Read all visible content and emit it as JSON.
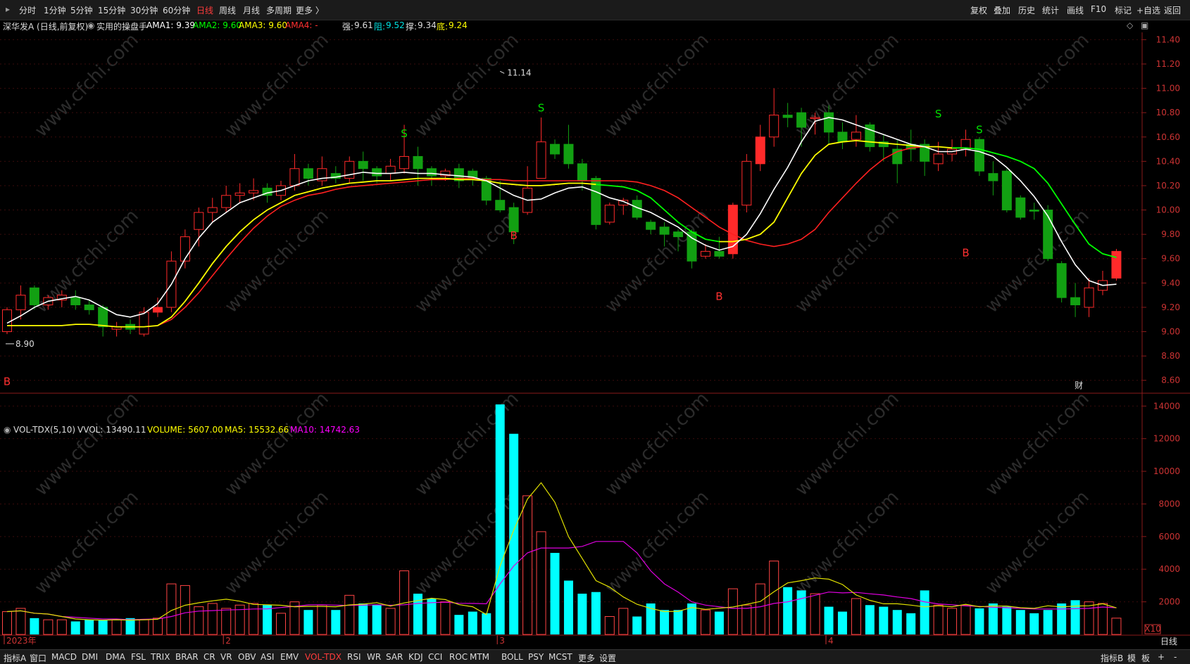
{
  "topbar": {
    "left_items": [
      "分时",
      "1分钟",
      "5分钟",
      "15分钟",
      "30分钟",
      "60分钟",
      "日线",
      "周线",
      "月线",
      "多周期",
      "更多 〉"
    ],
    "active_index": 6,
    "right_items": [
      "复权",
      "叠加",
      "历史",
      "统计",
      "画线",
      "F10",
      "标记",
      "+自选",
      "返回"
    ]
  },
  "info": {
    "stock": "深华发A (日线,前复权)",
    "indicator": "实用的操盘手",
    "ama1": "AMA1: 9.39",
    "ama2": "AMA2: 9.60",
    "ama3": "AMA3: 9.60",
    "ama4": "AMA4: -",
    "strong_label": "强:",
    "strong_value": "9.61",
    "resist_label": "阻:",
    "resist_value": "9.52",
    "support_label": "撑:",
    "support_value": "9.34",
    "bottom_label": "底:",
    "bottom_value": "9.24"
  },
  "volume_info": {
    "name": "VOL-TDX(5,10)",
    "vvol": "VVOL: 13490.11",
    "volume": "VOLUME: 5607.00",
    "ma5": "MA5: 15532.66",
    "ma10": "MA10: 14742.63"
  },
  "bottombar": {
    "items": [
      "指标A",
      "窗口",
      "MACD",
      "DMI",
      "DMA",
      "FSL",
      "TRIX",
      "BRAR",
      "CR",
      "VR",
      "OBV",
      "ASI",
      "EMV",
      "VOL-TDX",
      "RSI",
      "WR",
      "SAR",
      "KDJ",
      "CCI",
      "ROC",
      "MTM",
      "BOLL",
      "PSY",
      "MCST",
      "更多",
      "设置"
    ],
    "active_index": 13,
    "right_items": [
      "指标B",
      "模",
      "板",
      "+",
      "-"
    ]
  },
  "colors": {
    "up": "#ff2a2a",
    "down": "#12a012",
    "vol_up": "#ff4444",
    "vol_down": "#00ffff",
    "ama1": "#ffffff",
    "ama2_green": "#00ff00",
    "ama2_yellow": "#ffff00",
    "ama3_red": "#ff2020",
    "ma5": "#e0e000",
    "ma10": "#e000e0"
  },
  "chart_data": {
    "type": "candlestick",
    "price_ticks": [
      "11.40",
      "11.20",
      "11.00",
      "10.80",
      "10.60",
      "10.40",
      "10.20",
      "10.00",
      "9.80",
      "9.60",
      "9.40",
      "9.20",
      "9.00",
      "8.80",
      "8.60"
    ],
    "volume_ticks": [
      "14000",
      "12000",
      "10000",
      "8000",
      "6000",
      "4000",
      "2000"
    ],
    "volume_unit": "X10",
    "x_labels": [
      "2023年",
      "2",
      "3",
      "4"
    ],
    "period_label": "日线",
    "annotations": {
      "high": "11.14",
      "low": "8.90",
      "cai": "财"
    },
    "candles": [
      [
        9.0,
        9.18,
        9.2,
        8.98,
        1400
      ],
      [
        9.18,
        9.3,
        9.38,
        9.1,
        1600
      ],
      [
        9.36,
        9.22,
        9.38,
        9.18,
        1000
      ],
      [
        9.22,
        9.28,
        9.3,
        9.18,
        900
      ],
      [
        9.26,
        9.3,
        9.34,
        9.2,
        900
      ],
      [
        9.28,
        9.22,
        9.34,
        9.18,
        800
      ],
      [
        9.22,
        9.18,
        9.26,
        9.14,
        900
      ],
      [
        9.2,
        9.04,
        9.22,
        8.96,
        900
      ],
      [
        9.02,
        9.04,
        9.08,
        8.96,
        900
      ],
      [
        9.06,
        9.02,
        9.1,
        8.98,
        1000
      ],
      [
        8.98,
        9.16,
        9.2,
        8.96,
        900
      ],
      [
        9.16,
        9.2,
        9.28,
        9.12,
        1000
      ],
      [
        9.2,
        9.58,
        9.66,
        9.16,
        3100
      ],
      [
        9.58,
        9.78,
        9.84,
        9.52,
        3000
      ],
      [
        9.84,
        9.98,
        10.02,
        9.7,
        1700
      ],
      [
        9.98,
        10.02,
        10.1,
        9.9,
        1900
      ],
      [
        10.02,
        10.12,
        10.2,
        9.98,
        1600
      ],
      [
        10.12,
        10.14,
        10.22,
        10.06,
        1800
      ],
      [
        10.14,
        10.16,
        10.26,
        10.08,
        1900
      ],
      [
        10.18,
        10.12,
        10.22,
        10.06,
        1800
      ],
      [
        10.12,
        10.2,
        10.24,
        10.08,
        1300
      ],
      [
        10.2,
        10.34,
        10.46,
        10.16,
        2000
      ],
      [
        10.34,
        10.26,
        10.38,
        10.2,
        1500
      ],
      [
        10.24,
        10.34,
        10.44,
        10.2,
        1800
      ],
      [
        10.3,
        10.26,
        10.36,
        10.22,
        1500
      ],
      [
        10.26,
        10.4,
        10.44,
        10.22,
        2400
      ],
      [
        10.4,
        10.34,
        10.48,
        10.24,
        1900
      ],
      [
        10.34,
        10.28,
        10.36,
        10.22,
        1800
      ],
      [
        10.3,
        10.36,
        10.42,
        10.24,
        1600
      ],
      [
        10.34,
        10.44,
        10.7,
        10.3,
        3900
      ],
      [
        10.44,
        10.34,
        10.52,
        10.2,
        2500
      ],
      [
        10.34,
        10.28,
        10.36,
        10.2,
        2200
      ],
      [
        10.28,
        10.32,
        10.34,
        10.24,
        2000
      ],
      [
        10.34,
        10.24,
        10.38,
        10.18,
        1200
      ],
      [
        10.32,
        10.26,
        10.34,
        10.2,
        1400
      ],
      [
        10.26,
        10.08,
        10.28,
        10.04,
        1300
      ],
      [
        10.08,
        10.0,
        10.24,
        9.98,
        14100
      ],
      [
        10.02,
        9.82,
        10.06,
        9.72,
        12300
      ],
      [
        9.98,
        10.18,
        10.36,
        9.96,
        8500
      ],
      [
        10.26,
        10.56,
        10.76,
        10.26,
        6300
      ],
      [
        10.54,
        10.46,
        10.58,
        10.42,
        5000
      ],
      [
        10.54,
        10.38,
        10.7,
        10.34,
        3300
      ],
      [
        10.38,
        10.24,
        10.42,
        10.16,
        2500
      ],
      [
        10.26,
        9.88,
        10.28,
        9.84,
        2600
      ],
      [
        9.9,
        10.04,
        10.06,
        9.88,
        1100
      ],
      [
        10.04,
        10.08,
        10.1,
        9.96,
        1600
      ],
      [
        10.08,
        9.94,
        10.12,
        9.92,
        1100
      ],
      [
        9.9,
        9.84,
        9.92,
        9.8,
        1900
      ],
      [
        9.86,
        9.8,
        9.9,
        9.7,
        1500
      ],
      [
        9.82,
        9.78,
        9.84,
        9.66,
        1500
      ],
      [
        9.82,
        9.58,
        9.84,
        9.52,
        1900
      ],
      [
        9.62,
        9.66,
        9.72,
        9.6,
        1500
      ],
      [
        9.66,
        9.62,
        9.78,
        9.6,
        1400
      ],
      [
        9.64,
        10.04,
        10.06,
        9.6,
        2800
      ],
      [
        10.04,
        10.4,
        10.46,
        9.98,
        1800
      ],
      [
        10.38,
        10.6,
        10.7,
        10.32,
        3100
      ],
      [
        10.6,
        10.78,
        11.0,
        10.52,
        4500
      ],
      [
        10.78,
        10.76,
        10.88,
        10.68,
        2900
      ],
      [
        10.8,
        10.68,
        10.84,
        10.52,
        2700
      ],
      [
        10.76,
        10.76,
        10.8,
        10.62,
        2500
      ],
      [
        10.8,
        10.64,
        10.86,
        10.54,
        1700
      ],
      [
        10.64,
        10.56,
        10.72,
        10.5,
        1400
      ],
      [
        10.58,
        10.64,
        10.78,
        10.52,
        2200
      ],
      [
        10.7,
        10.52,
        10.72,
        10.48,
        1800
      ],
      [
        10.56,
        10.52,
        10.62,
        10.4,
        1700
      ],
      [
        10.5,
        10.38,
        10.58,
        10.22,
        1500
      ],
      [
        10.54,
        10.5,
        10.66,
        10.4,
        1300
      ],
      [
        10.54,
        10.4,
        10.58,
        10.28,
        2700
      ],
      [
        10.38,
        10.46,
        10.56,
        10.32,
        1800
      ],
      [
        10.46,
        10.5,
        10.58,
        10.4,
        1600
      ],
      [
        10.5,
        10.58,
        10.66,
        10.44,
        1800
      ],
      [
        10.58,
        10.32,
        10.6,
        10.28,
        1600
      ],
      [
        10.3,
        10.24,
        10.4,
        10.12,
        1900
      ],
      [
        10.32,
        10.0,
        10.34,
        9.98,
        1700
      ],
      [
        10.1,
        9.94,
        10.12,
        9.92,
        1500
      ],
      [
        10.0,
        9.99,
        10.06,
        9.92,
        1300
      ],
      [
        10.0,
        9.6,
        10.04,
        9.58,
        1500
      ],
      [
        9.56,
        9.28,
        9.58,
        9.24,
        1900
      ],
      [
        9.28,
        9.22,
        9.4,
        9.12,
        2100
      ],
      [
        9.2,
        9.36,
        9.44,
        9.12,
        2000
      ],
      [
        9.34,
        9.42,
        9.5,
        9.3,
        1900
      ],
      [
        9.44,
        9.66,
        9.68,
        9.42,
        1000
      ]
    ],
    "ama1": [
      9.07,
      9.13,
      9.2,
      9.25,
      9.27,
      9.29,
      9.26,
      9.2,
      9.14,
      9.12,
      9.15,
      9.23,
      9.39,
      9.6,
      9.77,
      9.9,
      9.98,
      10.06,
      10.1,
      10.14,
      10.16,
      10.2,
      10.24,
      10.26,
      10.27,
      10.29,
      10.31,
      10.3,
      10.3,
      10.31,
      10.3,
      10.3,
      10.29,
      10.28,
      10.27,
      10.24,
      10.18,
      10.12,
      10.08,
      10.09,
      10.14,
      10.18,
      10.19,
      10.15,
      10.1,
      10.07,
      10.02,
      9.98,
      9.92,
      9.86,
      9.77,
      9.71,
      9.67,
      9.7,
      9.8,
      9.97,
      10.17,
      10.35,
      10.56,
      10.73,
      10.76,
      10.74,
      10.7,
      10.66,
      10.62,
      10.58,
      10.54,
      10.52,
      10.48,
      10.48,
      10.5,
      10.48,
      10.44,
      10.35,
      10.24,
      10.11,
      9.95,
      9.74,
      9.55,
      9.42,
      9.38,
      9.39
    ],
    "ama2": {
      "values": [
        9.05,
        9.05,
        9.05,
        9.05,
        9.05,
        9.06,
        9.06,
        9.05,
        9.04,
        9.04,
        9.04,
        9.05,
        9.12,
        9.25,
        9.4,
        9.56,
        9.7,
        9.82,
        9.92,
        10.0,
        10.06,
        10.12,
        10.15,
        10.18,
        10.2,
        10.22,
        10.23,
        10.24,
        10.24,
        10.25,
        10.26,
        10.26,
        10.26,
        10.25,
        10.25,
        10.24,
        10.22,
        10.21,
        10.2,
        10.2,
        10.21,
        10.22,
        10.22,
        10.21,
        10.2,
        10.19,
        10.16,
        10.1,
        10.0,
        9.9,
        9.82,
        9.76,
        9.74,
        9.74,
        9.76,
        9.8,
        9.9,
        10.1,
        10.3,
        10.45,
        10.54,
        10.56,
        10.57,
        10.56,
        10.55,
        10.54,
        10.53,
        10.52,
        10.52,
        10.51,
        10.51,
        10.5,
        10.47,
        10.44,
        10.4,
        10.34,
        10.22,
        10.05,
        9.88,
        9.72,
        9.64,
        9.61
      ],
      "green_ranges": [
        [
          43,
          51
        ],
        [
          69,
          81
        ]
      ]
    },
    "ama3": {
      "start_index": 11,
      "end_index": 68,
      "values": [
        9.05,
        9.1,
        9.2,
        9.32,
        9.46,
        9.6,
        9.73,
        9.85,
        9.95,
        10.03,
        10.08,
        10.12,
        10.14,
        10.17,
        10.19,
        10.2,
        10.21,
        10.22,
        10.23,
        10.24,
        10.25,
        10.25,
        10.26,
        10.26,
        10.25,
        10.25,
        10.24,
        10.24,
        10.24,
        10.24,
        10.24,
        10.24,
        10.24,
        10.24,
        10.24,
        10.23,
        10.2,
        10.16,
        10.1,
        10.02,
        9.94,
        9.86,
        9.8,
        9.75,
        9.72,
        9.7,
        9.72,
        9.76,
        9.84,
        9.98,
        10.1,
        10.22,
        10.33,
        10.42,
        10.48,
        10.51,
        10.52,
        10.52
      ]
    },
    "vol_ma5": [
      1400,
      1450,
      1300,
      1250,
      1100,
      950,
      900,
      880,
      900,
      880,
      900,
      930,
      1470,
      1790,
      1940,
      2060,
      2160,
      2040,
      1840,
      1820,
      1790,
      1700,
      1720,
      1720,
      1700,
      1810,
      1860,
      1950,
      1740,
      1930,
      2080,
      2220,
      2140,
      1830,
      1700,
      1220,
      4200,
      6400,
      8300,
      9300,
      8100,
      6000,
      4650,
      3300,
      2900,
      2300,
      1850,
      1600,
      1400,
      1420,
      1650,
      1540,
      1610,
      1680,
      1850,
      2020,
      2620,
      3160,
      3300,
      3460,
      3390,
      3060,
      2420,
      2090,
      1880,
      1880,
      1800,
      1690,
      1760,
      1700,
      1850,
      1700,
      1740,
      1740,
      1640,
      1600,
      1760,
      1690,
      1740,
      1760,
      1880,
      1630
    ],
    "vol_ma10": [
      1400,
      1450,
      1300,
      1250,
      1100,
      1050,
      1000,
      950,
      950,
      900,
      930,
      950,
      1100,
      1330,
      1430,
      1460,
      1500,
      1520,
      1560,
      1570,
      1650,
      1720,
      1810,
      1820,
      1800,
      1780,
      1800,
      1820,
      1790,
      1820,
      1900,
      1950,
      1980,
      1910,
      1900,
      1880,
      3100,
      4200,
      5000,
      5300,
      5300,
      5300,
      5400,
      5700,
      5700,
      5700,
      5000,
      3900,
      3100,
      2600,
      2000,
      1800,
      1700,
      1600,
      1600,
      1700,
      1900,
      2000,
      2200,
      2400,
      2600,
      2550,
      2580,
      2490,
      2420,
      2300,
      2200,
      2000,
      1870,
      1820,
      1750,
      1720,
      1670,
      1640,
      1600,
      1560,
      1560,
      1560,
      1580,
      1600,
      1680,
      1640
    ],
    "signals": [
      {
        "label": "B",
        "index": 0,
        "price": 8.56,
        "color": "#ff3030"
      },
      {
        "label": "S",
        "index": 29,
        "price": 10.6,
        "color": "#00e000"
      },
      {
        "label": "B",
        "index": 37,
        "price": 9.76,
        "color": "#ff3030"
      },
      {
        "label": "S",
        "index": 39,
        "price": 10.81,
        "color": "#00e000"
      },
      {
        "label": "B",
        "index": 52,
        "price": 9.26,
        "color": "#ff3030"
      },
      {
        "label": "S",
        "index": 68,
        "price": 10.76,
        "color": "#00e000"
      },
      {
        "label": "S",
        "index": 71,
        "price": 10.63,
        "color": "#00e000"
      },
      {
        "label": "B",
        "index": 70,
        "price": 9.62,
        "color": "#ff3030"
      }
    ]
  }
}
